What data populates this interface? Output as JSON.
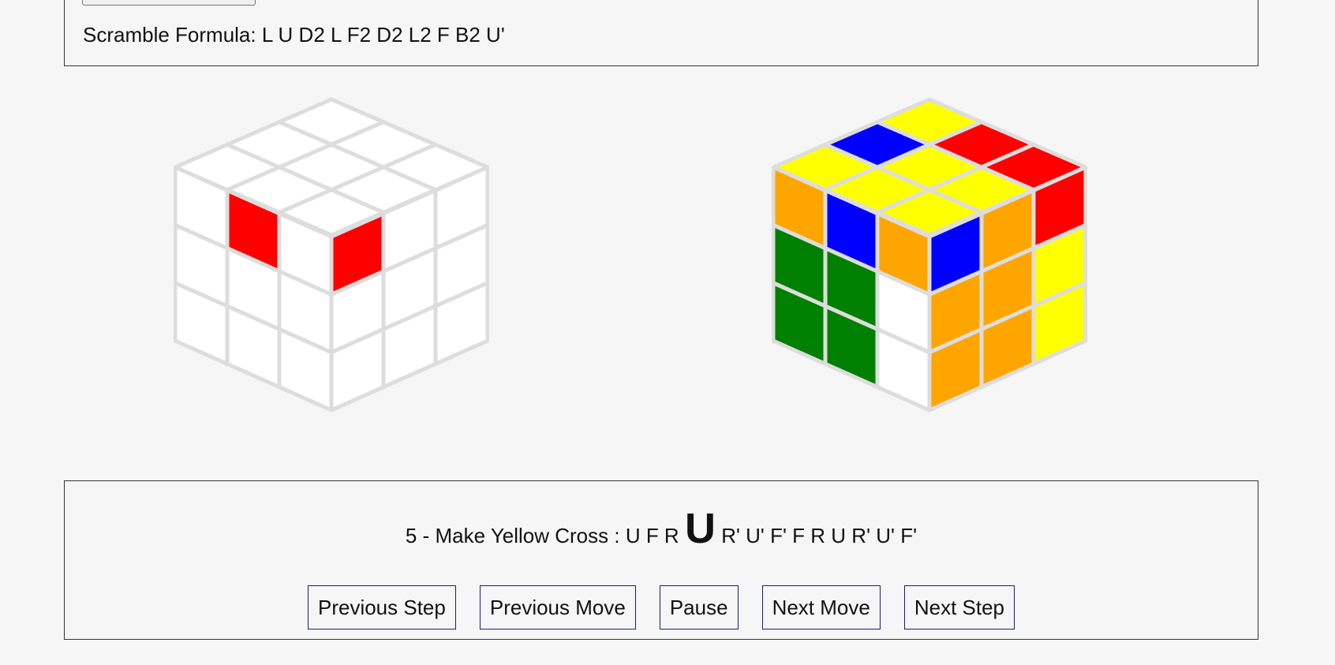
{
  "scramble": {
    "label": "Scramble Formula: L U D2 L F2 D2 L2 F B2 U'"
  },
  "step": {
    "prefix": "5 - Make Yellow Cross :",
    "moves_before": "U F R",
    "current_move": "U",
    "moves_after": "R' U' F' F R U R' U' F'"
  },
  "buttons": {
    "previous_step": "Previous Step",
    "previous_move": "Previous Move",
    "pause": "Pause",
    "next_move": "Next Move",
    "next_step": "Next Step"
  },
  "colors": {
    "white": "#ffffff",
    "red": "#ff0000",
    "yellow": "#ffff00",
    "blue": "#0000ff",
    "orange": "#ffa500",
    "green": "#008000",
    "grid": "#dddddd"
  },
  "cubes": {
    "target": {
      "top": [
        "white",
        "white",
        "white",
        "white",
        "white",
        "white",
        "white",
        "white",
        "white"
      ],
      "left": [
        "white",
        "red",
        "white",
        "white",
        "white",
        "white",
        "white",
        "white",
        "white"
      ],
      "right": [
        "red",
        "white",
        "white",
        "white",
        "white",
        "white",
        "white",
        "white",
        "white"
      ]
    },
    "current": {
      "top": [
        "yellow",
        "red",
        "red",
        "blue",
        "yellow",
        "yellow",
        "yellow",
        "yellow",
        "yellow"
      ],
      "left": [
        "orange",
        "blue",
        "orange",
        "green",
        "green",
        "white",
        "green",
        "green",
        "white"
      ],
      "right": [
        "blue",
        "orange",
        "red",
        "orange",
        "orange",
        "yellow",
        "orange",
        "orange",
        "yellow"
      ]
    }
  }
}
